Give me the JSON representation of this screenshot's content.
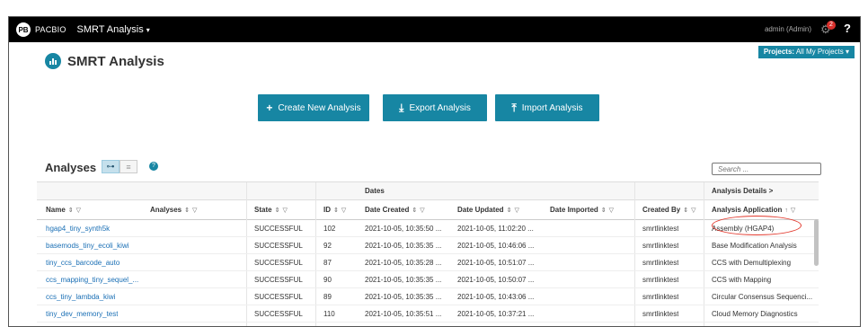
{
  "topbar": {
    "brand": "PACBIO",
    "logo_text": "PB",
    "app_name": "SMRT Analysis",
    "user": "admin (Admin)",
    "alert_count": "2",
    "help": "?"
  },
  "projects": {
    "label": "Projects:",
    "value": "All My Projects"
  },
  "page": {
    "title": "SMRT Analysis"
  },
  "actions": {
    "create": "Create New Analysis",
    "export": "Export Analysis",
    "import": "Import Analysis"
  },
  "analyses": {
    "title": "Analyses",
    "search_placeholder": "Search ...",
    "group_headers": {
      "dates": "Dates",
      "details": "Analysis Details >"
    },
    "columns": [
      "Name",
      "Analyses",
      "State",
      "ID",
      "Date Created",
      "Date Updated",
      "Date Imported",
      "Created By",
      "Analysis Application"
    ],
    "rows": [
      [
        "hgap4_tiny_synth5k",
        "",
        "SUCCESSFUL",
        "102",
        "2021-10-05, 10:35:50 ...",
        "2021-10-05, 11:02:20 ...",
        "",
        "smrtlinktest",
        "Assembly (HGAP4)"
      ],
      [
        "basemods_tiny_ecoli_kiwi",
        "",
        "SUCCESSFUL",
        "92",
        "2021-10-05, 10:35:35 ...",
        "2021-10-05, 10:46:06 ...",
        "",
        "smrtlinktest",
        "Base Modification Analysis"
      ],
      [
        "tiny_ccs_barcode_auto",
        "",
        "SUCCESSFUL",
        "87",
        "2021-10-05, 10:35:28 ...",
        "2021-10-05, 10:51:07 ...",
        "",
        "smrtlinktest",
        "CCS with Demultiplexing"
      ],
      [
        "ccs_mapping_tiny_sequel_...",
        "",
        "SUCCESSFUL",
        "90",
        "2021-10-05, 10:35:35 ...",
        "2021-10-05, 10:50:07 ...",
        "",
        "smrtlinktest",
        "CCS with Mapping"
      ],
      [
        "ccs_tiny_lambda_kiwi",
        "",
        "SUCCESSFUL",
        "89",
        "2021-10-05, 10:35:35 ...",
        "2021-10-05, 10:43:06 ...",
        "",
        "smrtlinktest",
        "Circular Consensus Sequenci..."
      ],
      [
        "tiny_dev_memory_test",
        "",
        "SUCCESSFUL",
        "110",
        "2021-10-05, 10:35:51 ...",
        "2021-10-05, 10:37:21 ...",
        "",
        "smrtlinktest",
        "Cloud Memory Diagnostics"
      ]
    ]
  },
  "icons": {
    "sort": "⇕",
    "filter": "▽",
    "sort_asc": "↑",
    "plus": "+",
    "download": "⤓",
    "upload": "⤒",
    "tree_view": "⊶",
    "list_view": "≡",
    "gear": "⚙",
    "caret": "▾",
    "info": "?"
  }
}
